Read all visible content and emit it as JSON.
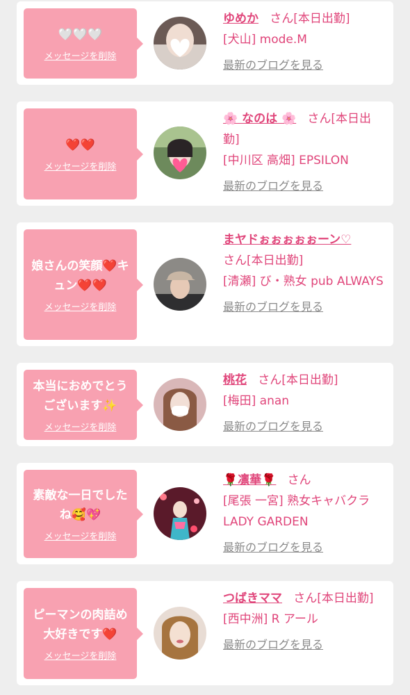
{
  "common": {
    "delete_label": "メッセージを削除",
    "blog_label": "最新のブログを見る"
  },
  "colors": {
    "bubble": "#f8a1b1",
    "accent": "#e0457a",
    "muted": "#8a8a8a",
    "background": "#eeeeee"
  },
  "items": [
    {
      "message": "🤍🤍🤍",
      "name": "ゆめか",
      "suffix": "さん[本日出勤]",
      "shop": "[犬山] mode.M",
      "avatar_icon": "heart-sticker-photo"
    },
    {
      "message": "❤️❤️",
      "name": "🌸 なのは 🌸",
      "suffix": "さん[本日出勤]",
      "shop": "[中川区 高畑] EPSILON",
      "avatar_icon": "heart-sticker-photo"
    },
    {
      "message": "娘さんの笑顔❤️キュン❤️❤️",
      "name": "まヤドぉぉぉぉぉーン♡",
      "suffix": "さん[本日出勤]",
      "shop": "[清瀬] び・熟女 pub ALWAYS",
      "avatar_icon": "cap-photo"
    },
    {
      "message": "本当におめでとうございます✨",
      "name": "桃花",
      "suffix": "さん[本日出勤]",
      "shop": "[梅田] anan",
      "avatar_icon": "mask-photo"
    },
    {
      "message": "素敵な一日でしたね🥰💖",
      "name": "🌹凛華🌹",
      "suffix": "さん",
      "shop": "[尾張 一宮] 熟女キャバクラ LADY GARDEN",
      "avatar_icon": "kimono-photo"
    },
    {
      "message": "ピーマンの肉詰め大好きです❤️",
      "name": "つばきママ",
      "suffix": "さん[本日出勤]",
      "shop": "[西中洲] R アール",
      "avatar_icon": "portrait-photo"
    }
  ]
}
